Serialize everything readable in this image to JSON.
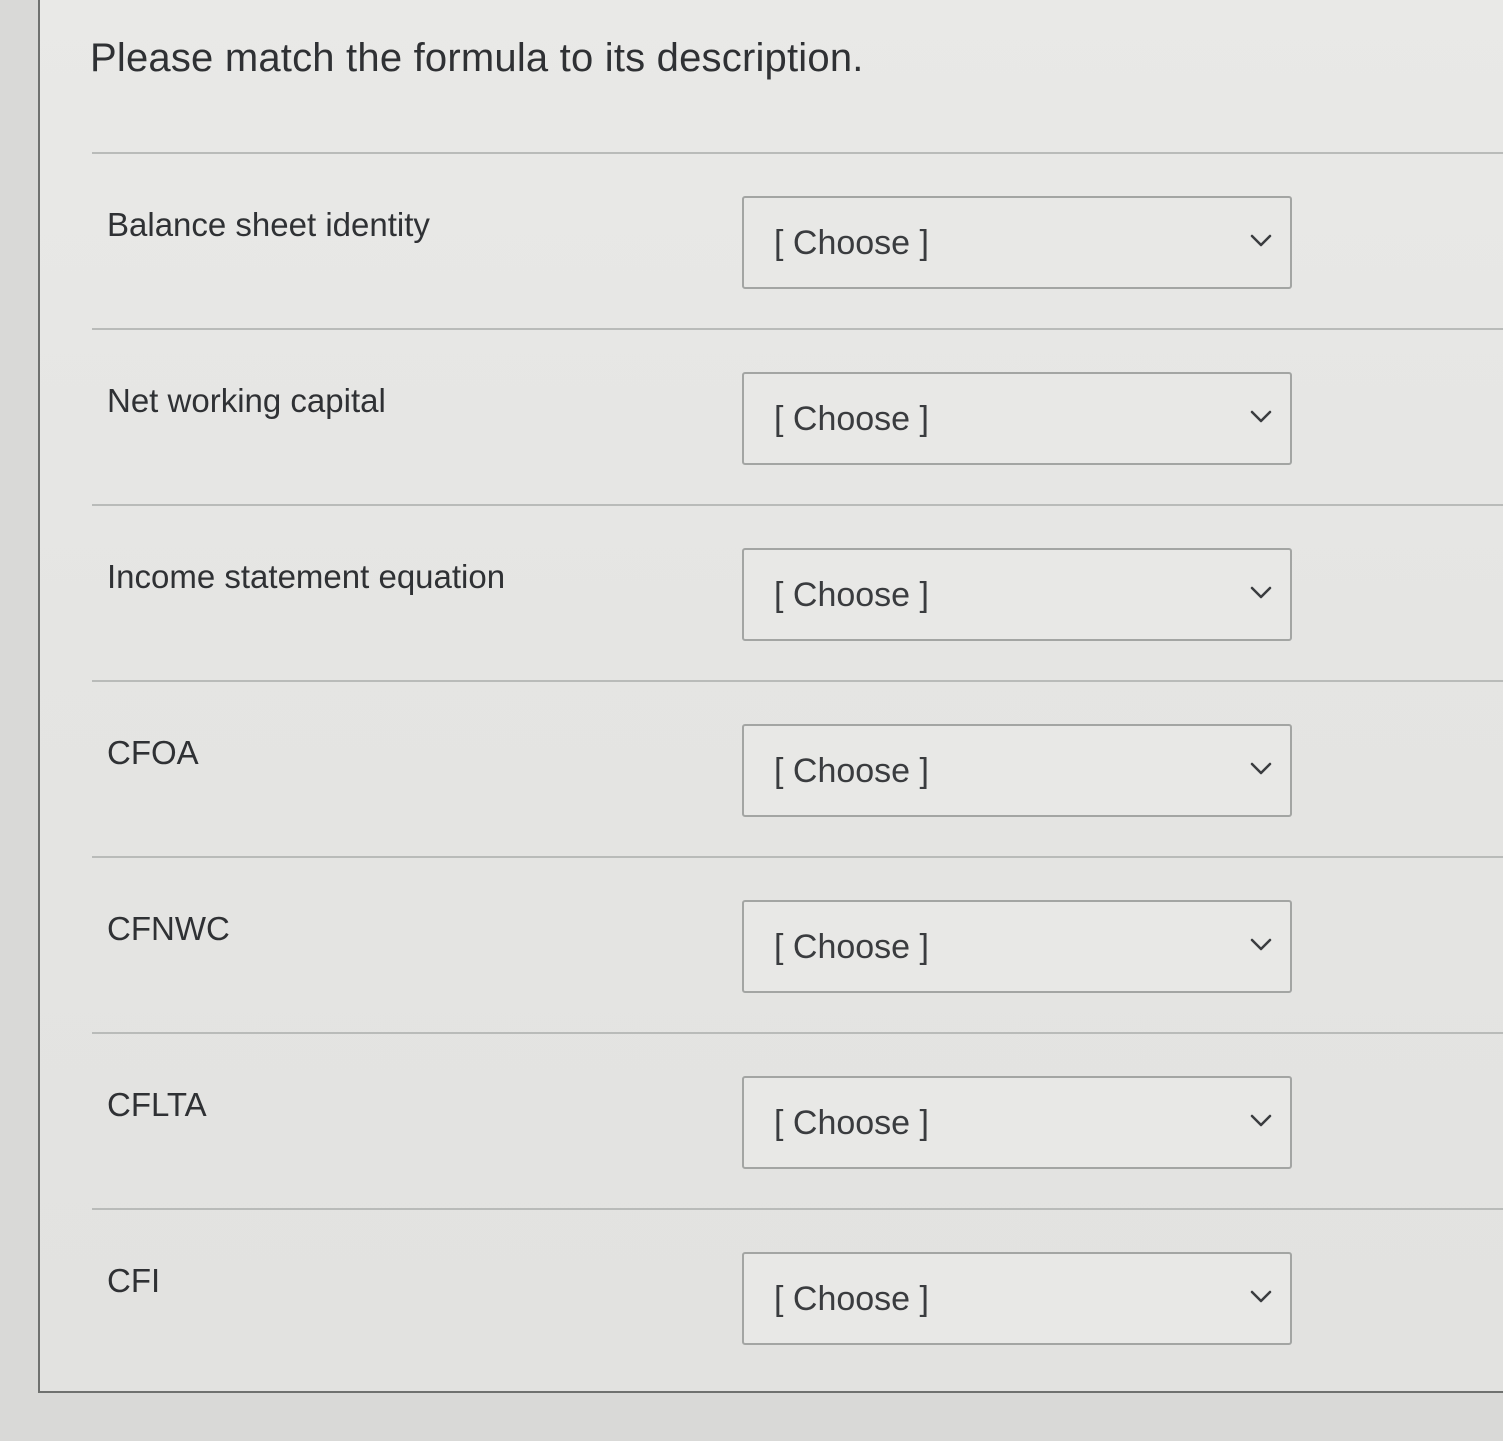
{
  "question": {
    "title": "Please match the formula to its description."
  },
  "rows": [
    {
      "label": "Balance sheet identity",
      "select_value": "[ Choose ]"
    },
    {
      "label": "Net working capital",
      "select_value": "[ Choose ]"
    },
    {
      "label": "Income statement equation",
      "select_value": "[ Choose ]"
    },
    {
      "label": "CFOA",
      "select_value": "[ Choose ]"
    },
    {
      "label": "CFNWC",
      "select_value": "[ Choose ]"
    },
    {
      "label": "CFLTA",
      "select_value": "[ Choose ]"
    },
    {
      "label": "CFI",
      "select_value": "[ Choose ]"
    }
  ],
  "icons": {
    "dropdown": "chevron-down-icon"
  }
}
